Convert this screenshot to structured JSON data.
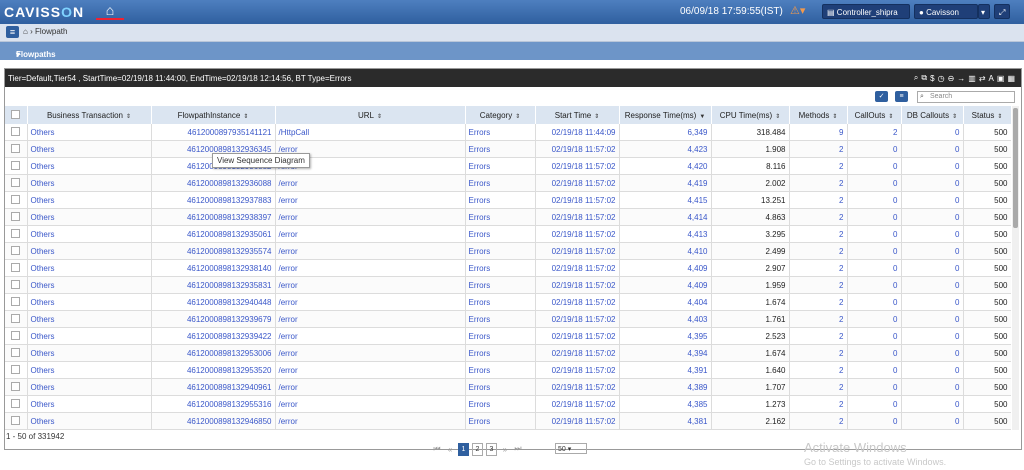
{
  "topbar": {
    "logo_prefix": "CAVISS",
    "logo_o": "O",
    "logo_suffix": "N",
    "datetime": "06/09/18 17:59:55(IST)",
    "controller_label": "Controller_shipra",
    "user_label": "Cavisson"
  },
  "breadcrumb": {
    "current": "Flowpath"
  },
  "section": {
    "title": "Flowpaths"
  },
  "panel": {
    "info": "Tier=Default,Tier54 , StartTime=02/19/18 11:44:00, EndTime=02/19/18 12:14:56, BT Type=Errors",
    "search_placeholder": "Search"
  },
  "table": {
    "columns": [
      "Business Transaction",
      "FlowpathInstance",
      "URL",
      "Category",
      "Start Time",
      "Response Time(ms)",
      "CPU Time(ms)",
      "Methods",
      "CallOuts",
      "DB Callouts",
      "Status"
    ],
    "rows": [
      [
        "Others",
        "4612000897935141121",
        "/HttpCall",
        "Errors",
        "02/19/18 11:44:09",
        "6,349",
        "318.484",
        "9",
        "2",
        "0",
        "500"
      ],
      [
        "Others",
        "4612000898132936345",
        "/error",
        "Errors",
        "02/19/18 11:57:02",
        "4,423",
        "1.908",
        "2",
        "0",
        "0",
        "500"
      ],
      [
        "Others",
        "4612000898132936882",
        "/error",
        "Errors",
        "02/19/18 11:57:02",
        "4,420",
        "8.116",
        "2",
        "0",
        "0",
        "500"
      ],
      [
        "Others",
        "4612000898132936088",
        "/error",
        "Errors",
        "02/19/18 11:57:02",
        "4,419",
        "2.002",
        "2",
        "0",
        "0",
        "500"
      ],
      [
        "Others",
        "4612000898132937883",
        "/error",
        "Errors",
        "02/19/18 11:57:02",
        "4,415",
        "13.251",
        "2",
        "0",
        "0",
        "500"
      ],
      [
        "Others",
        "4612000898132938397",
        "/error",
        "Errors",
        "02/19/18 11:57:02",
        "4,414",
        "4.863",
        "2",
        "0",
        "0",
        "500"
      ],
      [
        "Others",
        "4612000898132935061",
        "/error",
        "Errors",
        "02/19/18 11:57:02",
        "4,413",
        "3.295",
        "2",
        "0",
        "0",
        "500"
      ],
      [
        "Others",
        "4612000898132935574",
        "/error",
        "Errors",
        "02/19/18 11:57:02",
        "4,410",
        "2.499",
        "2",
        "0",
        "0",
        "500"
      ],
      [
        "Others",
        "4612000898132938140",
        "/error",
        "Errors",
        "02/19/18 11:57:02",
        "4,409",
        "2.907",
        "2",
        "0",
        "0",
        "500"
      ],
      [
        "Others",
        "4612000898132935831",
        "/error",
        "Errors",
        "02/19/18 11:57:02",
        "4,409",
        "1.959",
        "2",
        "0",
        "0",
        "500"
      ],
      [
        "Others",
        "4612000898132940448",
        "/error",
        "Errors",
        "02/19/18 11:57:02",
        "4,404",
        "1.674",
        "2",
        "0",
        "0",
        "500"
      ],
      [
        "Others",
        "4612000898132939679",
        "/error",
        "Errors",
        "02/19/18 11:57:02",
        "4,403",
        "1.761",
        "2",
        "0",
        "0",
        "500"
      ],
      [
        "Others",
        "4612000898132939422",
        "/error",
        "Errors",
        "02/19/18 11:57:02",
        "4,395",
        "2.523",
        "2",
        "0",
        "0",
        "500"
      ],
      [
        "Others",
        "4612000898132953006",
        "/error",
        "Errors",
        "02/19/18 11:57:02",
        "4,394",
        "1.674",
        "2",
        "0",
        "0",
        "500"
      ],
      [
        "Others",
        "4612000898132953520",
        "/error",
        "Errors",
        "02/19/18 11:57:02",
        "4,391",
        "1.640",
        "2",
        "0",
        "0",
        "500"
      ],
      [
        "Others",
        "4612000898132940961",
        "/error",
        "Errors",
        "02/19/18 11:57:02",
        "4,389",
        "1.707",
        "2",
        "0",
        "0",
        "500"
      ],
      [
        "Others",
        "4612000898132955316",
        "/error",
        "Errors",
        "02/19/18 11:57:02",
        "4,385",
        "1.273",
        "2",
        "0",
        "0",
        "500"
      ],
      [
        "Others",
        "4612000898132946850",
        "/error",
        "Errors",
        "02/19/18 11:57:02",
        "4,381",
        "2.162",
        "2",
        "0",
        "0",
        "500"
      ]
    ]
  },
  "tooltip": "View Sequence Diagram",
  "footer": {
    "count": "1 - 50 of 331942",
    "page_size": "50",
    "pages": [
      "1",
      "2",
      "3"
    ]
  },
  "watermark": {
    "line1": "Activate Windows",
    "line2": "Go to Settings to activate Windows."
  },
  "colors": {
    "topbar": "#2f5f9f",
    "link": "#3a57c9",
    "header_bg": "#dbe5f1"
  }
}
